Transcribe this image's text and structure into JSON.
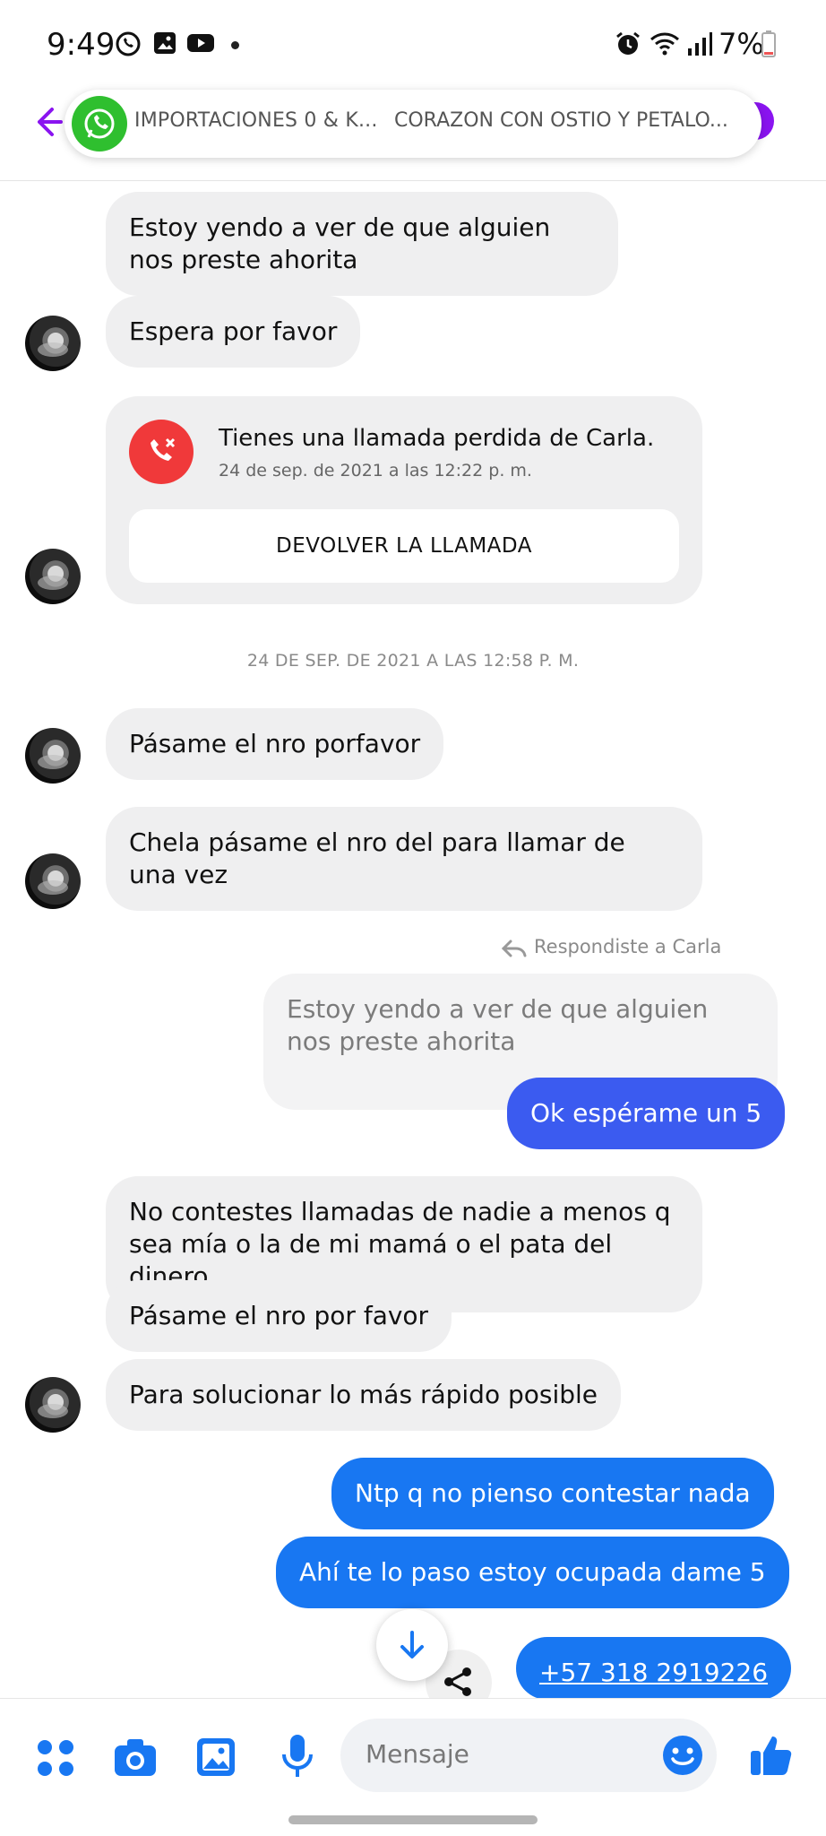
{
  "status_bar": {
    "time": "9:49",
    "battery": "7%",
    "icons": [
      "whatsapp-icon",
      "gallery-icon",
      "youtube-icon",
      "alarm-icon",
      "wifi-icon",
      "signal-icon",
      "battery-icon"
    ]
  },
  "header": {
    "notification_title": "IMPORTACIONES 0 & K...",
    "notification_text": "CORAZON CON OSTIO Y PETALO...",
    "colors": {
      "accent": "#8a14f0",
      "whatsapp": "#2fbf2f"
    }
  },
  "messages": {
    "m1": "Estoy yendo a ver de que alguien nos preste ahorita",
    "m2": "Espera por favor",
    "missed_call": {
      "title": "Tienes una llamada perdida de Carla.",
      "time": "24 de sep. de 2021 a las 12:22 p. m.",
      "button": "DEVOLVER LA LLAMADA"
    },
    "timestamp": "24 DE SEP. DE 2021 A LAS 12:58 P. M.",
    "m3": "Pásame el nro porfavor",
    "m4": "Chela pásame el nro del para llamar de una vez",
    "reply_note": "Respondiste a Carla",
    "quoted": "Estoy yendo a ver de que alguien nos preste ahorita",
    "m5": "Ok espérame un 5",
    "m6": "No contestes llamadas de nadie a menos q sea mía o la de mi mamá o el pata del dinero",
    "m7": "Pásame el nro por favor",
    "m8": "Para solucionar lo más rápido posible",
    "m9": "Ntp q no pienso contestar nada",
    "m10": "Ahí te lo paso estoy ocupada dame 5",
    "m11": "+57 318 2919226"
  },
  "composer": {
    "placeholder": "Mensaje",
    "tools": [
      "menu-dots-icon",
      "camera-icon",
      "image-icon",
      "microphone-icon",
      "emoji-icon",
      "like-icon"
    ],
    "colors": {
      "icon": "#1877f2"
    }
  }
}
